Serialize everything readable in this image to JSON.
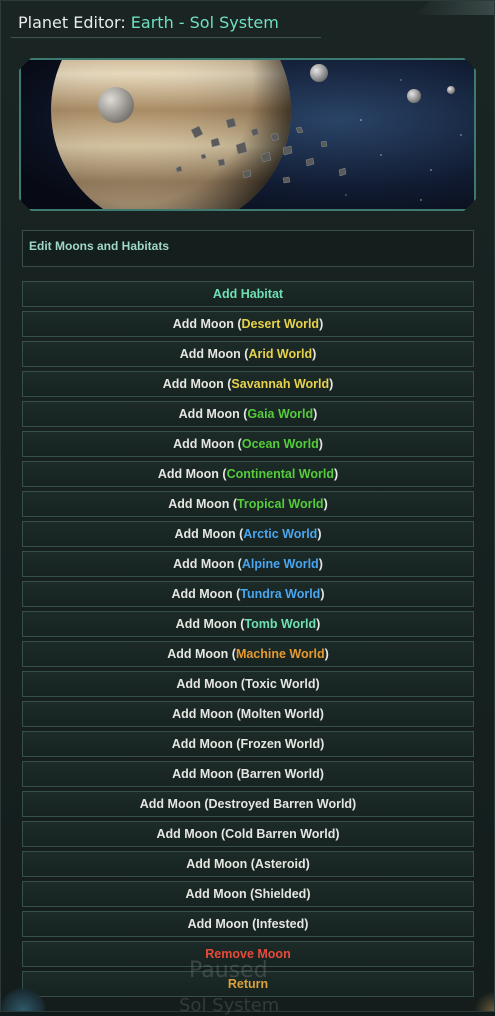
{
  "window": {
    "title_label": "Planet Editor: ",
    "title_value": "Earth - Sol System"
  },
  "section": {
    "header": "Edit Moons and Habitats"
  },
  "buttons": [
    {
      "prefix": "",
      "kind": "Add Habitat",
      "suffix": "",
      "color": "#6fe0b4"
    },
    {
      "prefix": "Add Moon (",
      "kind": "Desert World",
      "suffix": ")",
      "color": "#e8d24a"
    },
    {
      "prefix": "Add Moon (",
      "kind": "Arid World",
      "suffix": ")",
      "color": "#e8d24a"
    },
    {
      "prefix": "Add Moon (",
      "kind": "Savannah World",
      "suffix": ")",
      "color": "#e8d24a"
    },
    {
      "prefix": "Add Moon (",
      "kind": "Gaia World",
      "suffix": ")",
      "color": "#55cc3a"
    },
    {
      "prefix": "Add Moon (",
      "kind": "Ocean World",
      "suffix": ")",
      "color": "#55cc3a"
    },
    {
      "prefix": "Add Moon (",
      "kind": "Continental World",
      "suffix": ")",
      "color": "#55cc3a"
    },
    {
      "prefix": "Add Moon (",
      "kind": "Tropical World",
      "suffix": ")",
      "color": "#55cc3a"
    },
    {
      "prefix": "Add Moon (",
      "kind": "Arctic World",
      "suffix": ")",
      "color": "#4aa6f0"
    },
    {
      "prefix": "Add Moon (",
      "kind": "Alpine World",
      "suffix": ")",
      "color": "#4aa6f0"
    },
    {
      "prefix": "Add Moon (",
      "kind": "Tundra World",
      "suffix": ")",
      "color": "#4aa6f0"
    },
    {
      "prefix": "Add Moon (",
      "kind": "Tomb World",
      "suffix": ")",
      "color": "#6fe0b4"
    },
    {
      "prefix": "Add Moon (",
      "kind": "Machine World",
      "suffix": ")",
      "color": "#e69a2e"
    },
    {
      "prefix": "Add Moon (Toxic World)",
      "kind": "",
      "suffix": "",
      "color": "#e6e6e2"
    },
    {
      "prefix": "Add Moon (Molten World)",
      "kind": "",
      "suffix": "",
      "color": "#e6e6e2"
    },
    {
      "prefix": "Add Moon (Frozen World)",
      "kind": "",
      "suffix": "",
      "color": "#e6e6e2"
    },
    {
      "prefix": "Add Moon (Barren World)",
      "kind": "",
      "suffix": "",
      "color": "#e6e6e2"
    },
    {
      "prefix": "Add Moon (Destroyed Barren World)",
      "kind": "",
      "suffix": "",
      "color": "#e6e6e2"
    },
    {
      "prefix": "Add Moon (Cold Barren World)",
      "kind": "",
      "suffix": "",
      "color": "#e6e6e2"
    },
    {
      "prefix": "Add Moon (Asteroid)",
      "kind": "",
      "suffix": "",
      "color": "#e6e6e2"
    },
    {
      "prefix": "Add Moon (Shielded)",
      "kind": "",
      "suffix": "",
      "color": "#e6e6e2"
    },
    {
      "prefix": "Add Moon (Infested)",
      "kind": "",
      "suffix": "",
      "color": "#e6e6e2"
    },
    {
      "prefix": "",
      "kind": "Remove Moon",
      "suffix": "",
      "color": "#e84a3a"
    },
    {
      "prefix": "",
      "kind": "Return",
      "suffix": "",
      "color": "#d9a23a"
    }
  ],
  "overlay": {
    "paused": "Paused",
    "system": "Sol System"
  }
}
